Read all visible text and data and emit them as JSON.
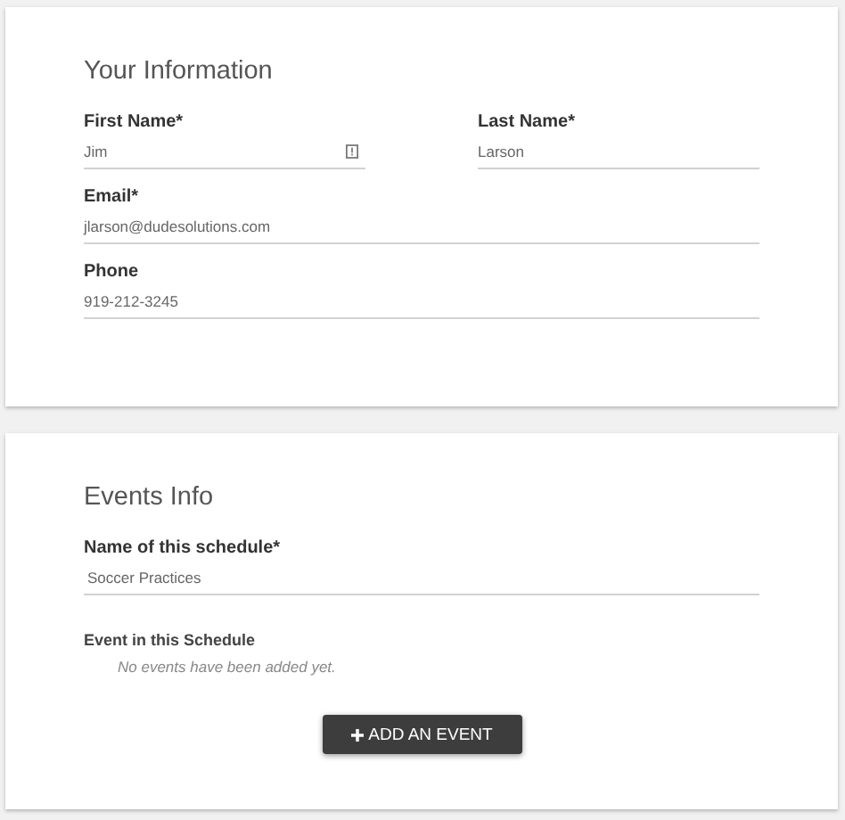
{
  "sections": [
    {
      "title": "Your Information",
      "rows": [
        [
          {
            "label": "First Name*",
            "value": "Jim",
            "alert_icon": true
          },
          {
            "label": "Last Name*",
            "value": "Larson",
            "alert_icon": false
          }
        ],
        [
          {
            "label": "Email*",
            "value": "jlarson@dudesolutions.com",
            "alert_icon": false
          }
        ],
        [
          {
            "label": "Phone",
            "value": "919-212-3245",
            "alert_icon": false
          }
        ]
      ]
    },
    {
      "title": "Events Info",
      "rows": [
        [
          {
            "label": "Name of this schedule*",
            "value": "Soccer Practices",
            "alert_icon": false
          }
        ]
      ],
      "events": {
        "label": "Event in this Schedule",
        "empty_text": "No events have been added yet."
      },
      "button": {
        "label": "ADD AN EVENT"
      }
    }
  ]
}
